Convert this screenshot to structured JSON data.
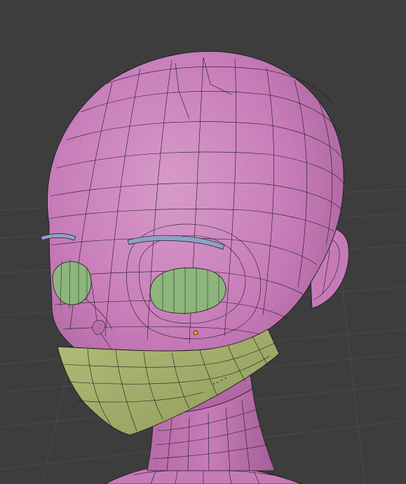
{
  "viewport": {
    "mode": "edit-mode",
    "background": "#3d3d3d",
    "grid_line_color": "#4a4a4a"
  },
  "mesh": {
    "head_color": "#c67bb8",
    "head_shadow": "#9e5a92",
    "head_highlight": "#d79ac9",
    "wire_color": "#1a1a1a",
    "eye_color": "#8db57c",
    "mask_color": "#a8b26f",
    "brow_color": "#8ea0c8",
    "origin_color": "#ff9a1f"
  }
}
